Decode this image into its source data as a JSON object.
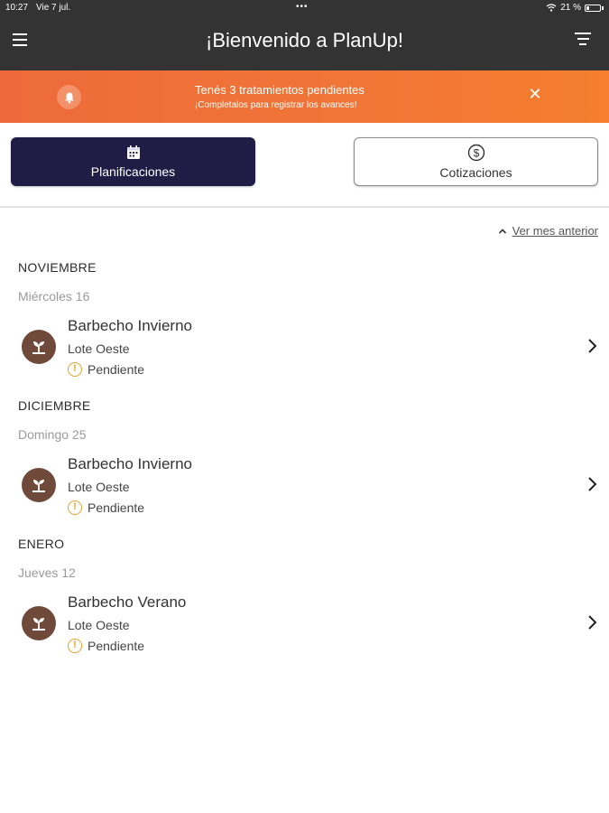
{
  "statusbar": {
    "time": "10:27",
    "date": "Vie 7 jul.",
    "dots": "•••",
    "battery": "21 %"
  },
  "appbar": {
    "title": "¡Bienvenido a PlanUp!",
    "menu_icon": "menu-icon",
    "filter_icon": "filter-icon"
  },
  "banner": {
    "line1": "Tenés 3 tratamientos pendientes",
    "line2": "¡Completalos para registrar los avances!",
    "bell_icon": "bell-icon",
    "close_icon": "close-icon",
    "color_start": "#ee6a3a",
    "color_end": "#f57f2e"
  },
  "segments": {
    "planificaciones": {
      "label": "Planificaciones",
      "icon": "calendar-icon",
      "active": true
    },
    "cotizaciones": {
      "label": "Cotizaciones",
      "icon": "dollar-circle-icon",
      "active": false
    }
  },
  "prev_month_link": "Ver mes anterior",
  "groups": [
    {
      "month": "NOVIEMBRE",
      "day": "Miércoles 16",
      "item": {
        "title": "Barbecho Invierno",
        "lote": "Lote Oeste",
        "status": "Pendiente"
      }
    },
    {
      "month": "DICIEMBRE",
      "day": "Domingo 25",
      "item": {
        "title": "Barbecho Invierno",
        "lote": "Lote Oeste",
        "status": "Pendiente"
      }
    },
    {
      "month": "ENERO",
      "day": "Jueves 12",
      "item": {
        "title": "Barbecho Verano",
        "lote": "Lote Oeste",
        "status": "Pendiente"
      }
    }
  ],
  "colors": {
    "appbar": "#333333",
    "active_segment": "#211c45",
    "avatar": "#6f4a3b",
    "warning": "#e2a32a"
  }
}
